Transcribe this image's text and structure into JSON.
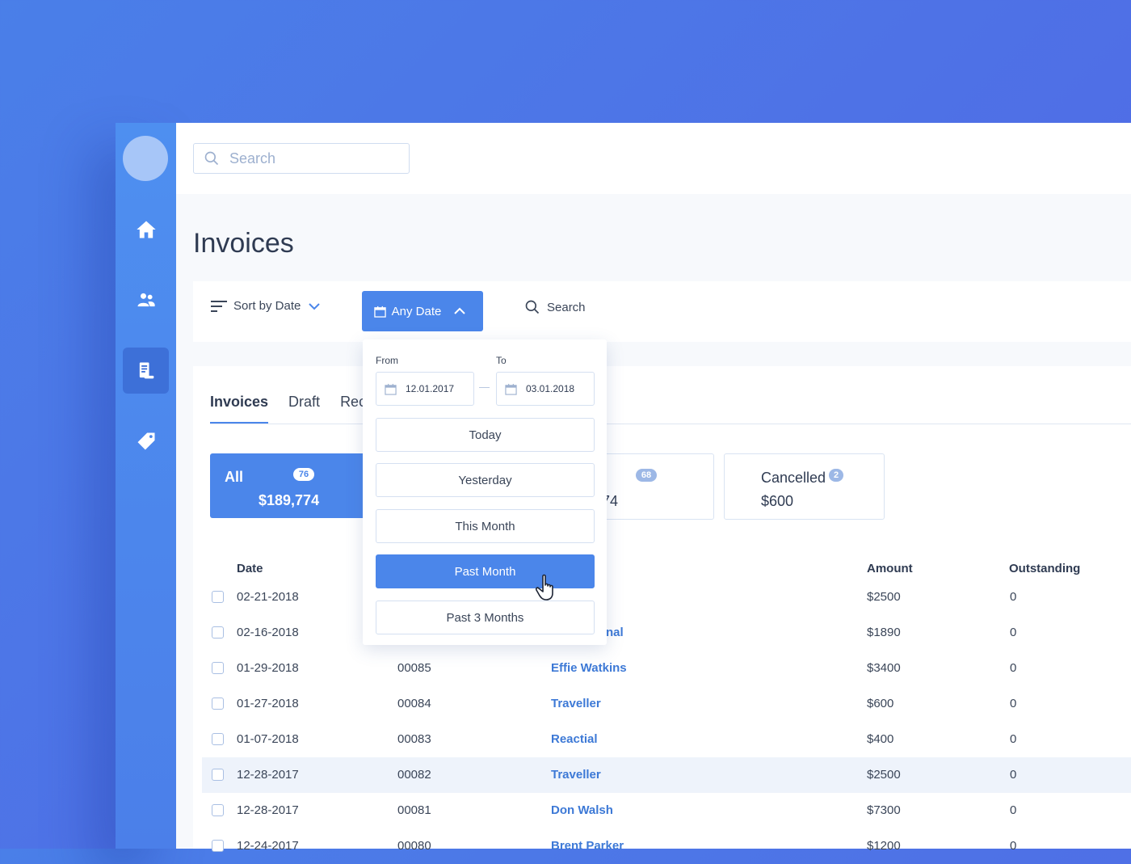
{
  "topbar": {
    "search_placeholder": "Search"
  },
  "page": {
    "title": "Invoices"
  },
  "filters": {
    "sort_label": "Sort by Date",
    "date_label": "Any Date",
    "search_label": "Search"
  },
  "tabs": [
    {
      "label": "Invoices",
      "active": true
    },
    {
      "label": "Draft"
    },
    {
      "label": "Rec"
    }
  ],
  "summaries": {
    "all": {
      "label": "All",
      "badge": "76",
      "amount": "$189,774"
    },
    "partial": {
      "badge": "68",
      "amount": "74"
    },
    "cancelled": {
      "label": "Cancelled",
      "badge": "2",
      "amount": "$600"
    }
  },
  "table": {
    "headers": {
      "date": "Date",
      "amount": "Amount",
      "outstanding": "Outstanding"
    },
    "rows": [
      {
        "date": "02-21-2018",
        "number": "",
        "client": "",
        "amount": "$2500",
        "outstanding": "0"
      },
      {
        "date": "02-16-2018",
        "number": "",
        "client": "nal",
        "amount": "$1890",
        "outstanding": "0"
      },
      {
        "date": "01-29-2018",
        "number": "00085",
        "client": "Effie Watkins",
        "amount": "$3400",
        "outstanding": "0"
      },
      {
        "date": "01-27-2018",
        "number": "00084",
        "client": "Traveller",
        "amount": "$600",
        "outstanding": "0"
      },
      {
        "date": "01-07-2018",
        "number": "00083",
        "client": "Reactial",
        "amount": "$400",
        "outstanding": "0"
      },
      {
        "date": "12-28-2017",
        "number": "00082",
        "client": "Traveller",
        "amount": "$2500",
        "outstanding": "0"
      },
      {
        "date": "12-28-2017",
        "number": "00081",
        "client": "Don Walsh",
        "amount": "$7300",
        "outstanding": "0"
      },
      {
        "date": "12-24-2017",
        "number": "00080",
        "client": "Brent Parker",
        "amount": "$1200",
        "outstanding": "0"
      }
    ]
  },
  "date_dropdown": {
    "from_label": "From",
    "to_label": "To",
    "from_value": "12.01.2017",
    "to_value": "03.01.2018",
    "options": [
      "Today",
      "Yesterday",
      "This Month",
      "Past Month",
      "Past 3 Months"
    ],
    "selected": "Past Month"
  },
  "colors": {
    "accent": "#4b86ea",
    "sidebar": "#4e8ff0",
    "background": "#4f6fe6",
    "link": "#3d79d6"
  },
  "icons": [
    "home-icon",
    "users-icon",
    "invoice-icon",
    "tag-icon",
    "search-icon",
    "calendar-icon",
    "sort-icon",
    "chevron-down-icon",
    "chevron-up-icon",
    "hand-cursor-icon"
  ]
}
